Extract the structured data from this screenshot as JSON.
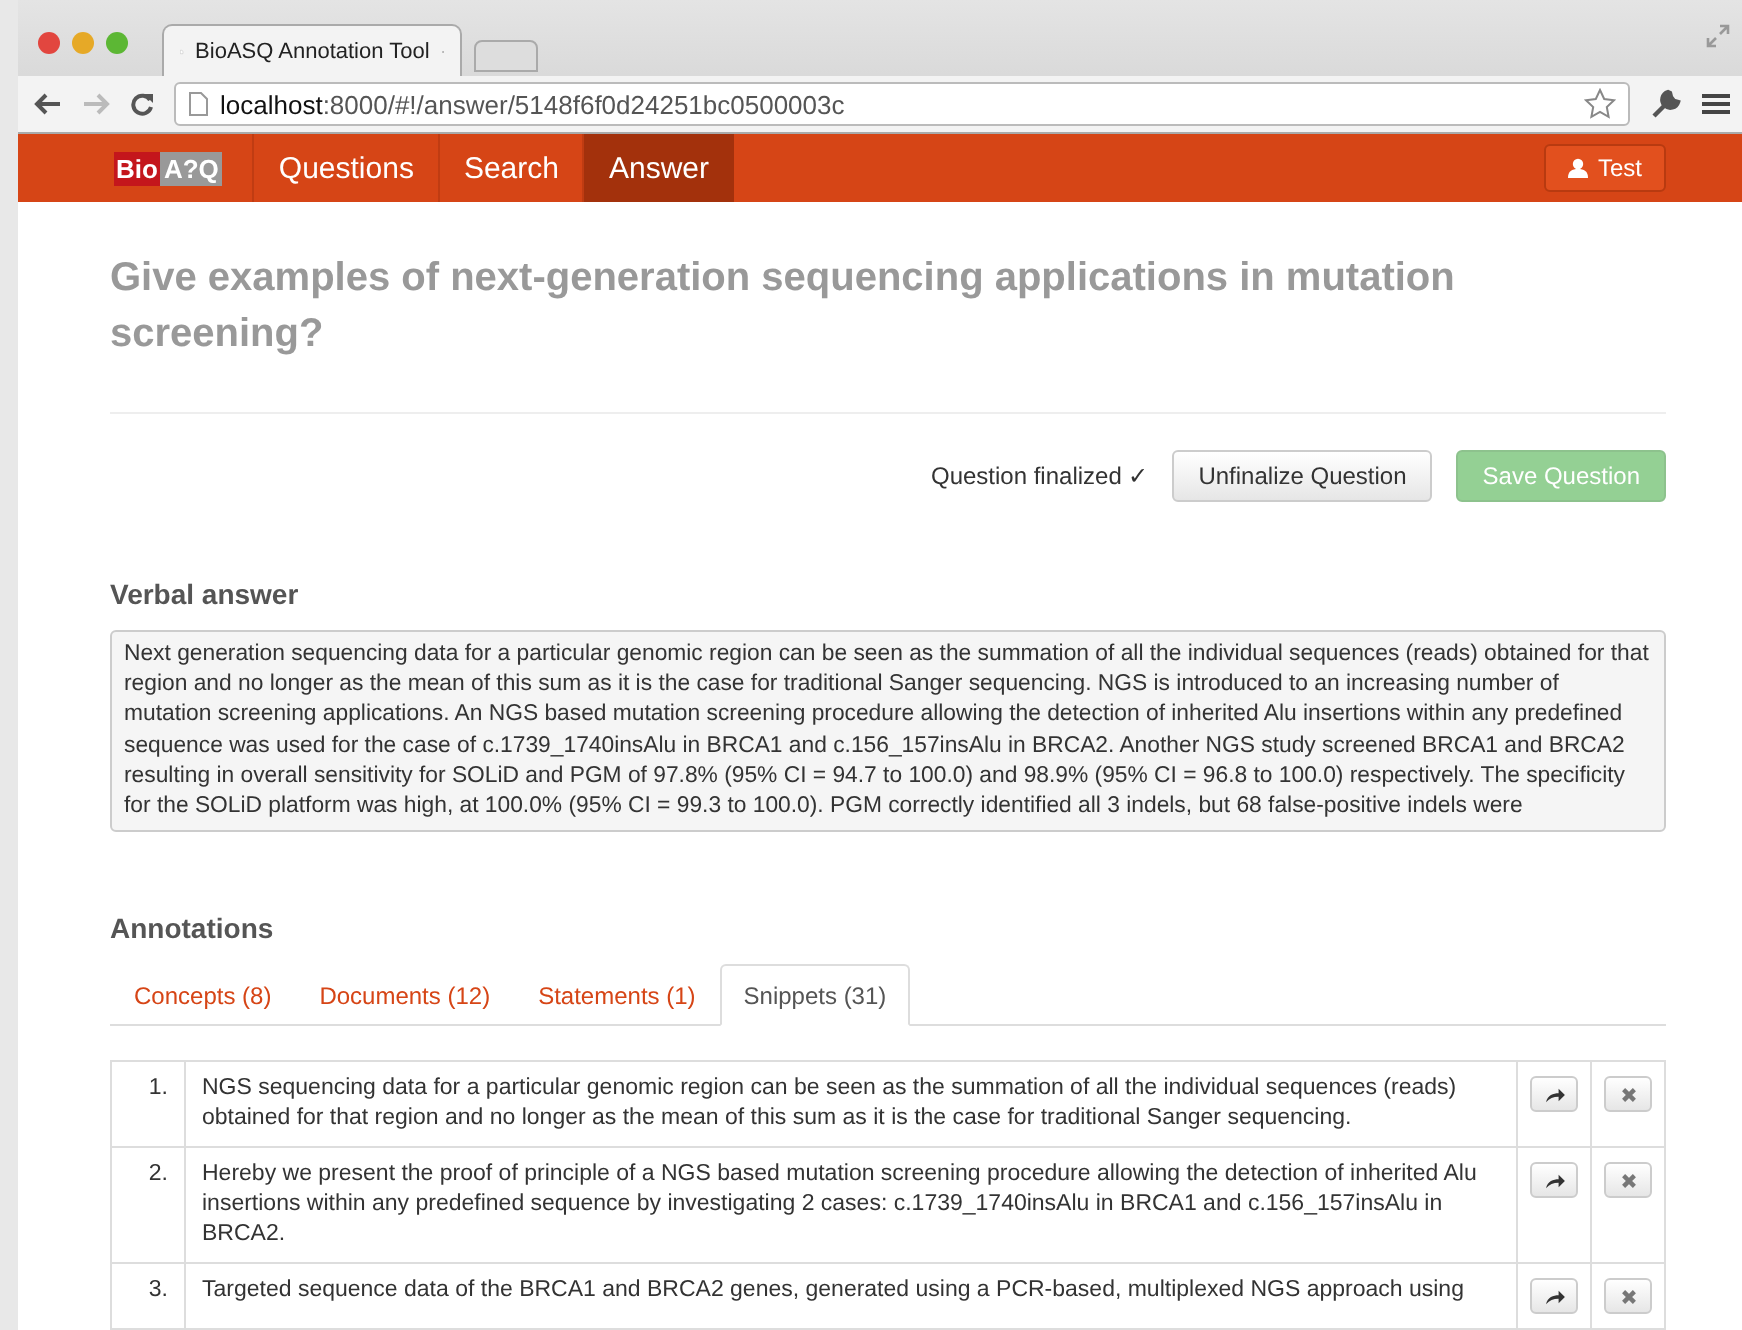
{
  "browser": {
    "tab_title": "BioASQ Annotation Tool",
    "url_host": "localhost",
    "url_rest": ":8000/#!/answer/5148f6f0d24251bc0500003c"
  },
  "navbar": {
    "logo_left": "Bio",
    "logo_right": "A?Q",
    "items": [
      {
        "label": "Questions",
        "selected": false
      },
      {
        "label": "Search",
        "selected": false
      },
      {
        "label": "Answer",
        "selected": true
      }
    ],
    "user": "Test"
  },
  "question": "Give examples of next-generation sequencing applications in mutation screening?",
  "status": "Question finalized ✓",
  "buttons": [
    {
      "label": "Unfinalize Question",
      "kind": "default",
      "disabled": false
    },
    {
      "label": "Save Question",
      "kind": "success",
      "disabled": true
    }
  ],
  "verbal_answer": {
    "heading": "Verbal answer",
    "value": "Next generation sequencing data for a particular genomic region can be seen as the summation of all the individual sequences (reads) obtained for that region and no longer as the mean of this sum as it is the case for traditional Sanger sequencing. NGS is introduced to an increasing number of mutation screening applications. An NGS based mutation screening procedure allowing the detection of inherited Alu insertions within any predefined sequence was used for the case of c.1739_1740insAlu in BRCA1 and c.156_157insAlu in BRCA2. Another NGS study screened BRCA1 and BRCA2 resulting in  overall sensitivity for SOLiD and PGM of 97.8% (95% CI = 94.7 to 100.0) and 98.9% (95% CI = 96.8 to 100.0) respectively. The specificity for the SOLiD platform was high, at 100.0% (95% CI = 99.3 to 100.0). PGM correctly identified all 3 indels, but 68 false-positive indels were"
  },
  "annotations": {
    "heading": "Annotations",
    "tabs": [
      {
        "label": "Concepts (8)",
        "selected": false
      },
      {
        "label": "Documents (12)",
        "selected": false
      },
      {
        "label": "Statements (1)",
        "selected": false
      },
      {
        "label": "Snippets (31)",
        "selected": true
      }
    ],
    "rows": [
      {
        "number": "1.",
        "text": "NGS sequencing data for a particular genomic region can be seen as the summation of all the individual sequences (reads) obtained for that region and no longer as the mean of this sum as it is the case for traditional Sanger sequencing."
      },
      {
        "number": "2.",
        "text": "Hereby we present the proof of principle of a NGS based mutation screening procedure allowing the detection of inherited Alu insertions within any predefined sequence by investigating 2 cases: c.1739_1740insAlu in BRCA1 and c.156_157insAlu in BRCA2."
      },
      {
        "number": "3.",
        "text": "Targeted sequence data of the BRCA1 and BRCA2 genes, generated using a PCR-based, multiplexed NGS approach using"
      }
    ]
  }
}
